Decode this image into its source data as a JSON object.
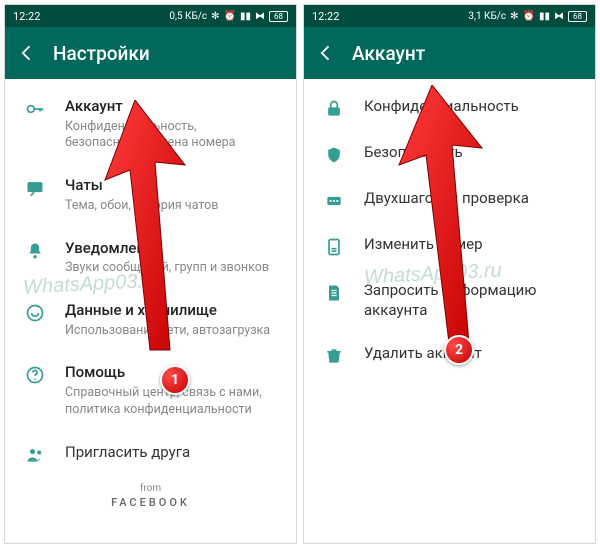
{
  "status": {
    "time": "12:22",
    "net_left": "0,5 КБ/с",
    "net_right": "3,1 КБ/с",
    "battery": "68"
  },
  "left": {
    "title": "Настройки",
    "items": [
      {
        "icon": "key-icon",
        "title": "Аккаунт",
        "sub": "Конфиденциальность, безопасность, смена номера"
      },
      {
        "icon": "chat-icon",
        "title": "Чаты",
        "sub": "Тема, обои, история чатов"
      },
      {
        "icon": "bell-icon",
        "title": "Уведомления",
        "sub": "Звуки сообщений, групп и звонков"
      },
      {
        "icon": "data-icon",
        "title": "Данные и хранилище",
        "sub": "Использование сети, автозагрузка"
      },
      {
        "icon": "help-icon",
        "title": "Помощь",
        "sub": "Справочный центр, связь с нами, политика конфиденциальности"
      }
    ],
    "invite": "Пригласить друга",
    "from": "from",
    "brand": "FACEBOOK",
    "badge": "1",
    "watermark": "WhatsApp03.ru"
  },
  "right": {
    "title": "Аккаунт",
    "items": [
      {
        "icon": "lock-icon",
        "title": "Конфиденциальность"
      },
      {
        "icon": "shield-icon",
        "title": "Безопасность"
      },
      {
        "icon": "twostep-icon",
        "title": "Двухшаговая проверка"
      },
      {
        "icon": "sim-icon",
        "title": "Изменить номер"
      },
      {
        "icon": "doc-icon",
        "title": "Запросить информацию аккаунта"
      },
      {
        "icon": "trash-icon",
        "title": "Удалить аккаунт"
      }
    ],
    "badge": "2",
    "watermark": "WhatsApp03.ru"
  }
}
